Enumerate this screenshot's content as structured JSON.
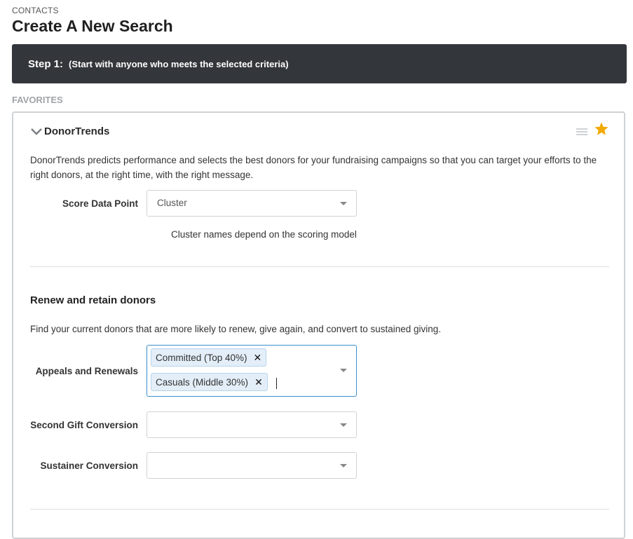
{
  "breadcrumb": "CONTACTS",
  "page_title": "Create A New Search",
  "step": {
    "label": "Step 1:",
    "description": "(Start with anyone who meets the selected criteria)"
  },
  "favorites_label": "FAVORITES",
  "panel": {
    "title": "DonorTrends",
    "description": "DonorTrends predicts performance and selects the best donors for your fundraising campaigns so that you can target your efforts to the right donors, at the right time, with the right message.",
    "score_data_point": {
      "label": "Score Data Point",
      "value": "Cluster",
      "hint": "Cluster names depend on the scoring model"
    },
    "section": {
      "title": "Renew and retain donors",
      "description": "Find your current donors that are more likely to renew, give again, and convert to sustained giving."
    },
    "appeals_renewals": {
      "label": "Appeals and Renewals",
      "tags": [
        "Committed (Top 40%)",
        "Casuals (Middle 30%)"
      ],
      "remove_glyph": "✕"
    },
    "second_gift": {
      "label": "Second Gift Conversion",
      "value": ""
    },
    "sustainer": {
      "label": "Sustainer Conversion",
      "value": ""
    }
  },
  "colors": {
    "step_bar": "#33363a",
    "star": "#f2a900",
    "focus_border": "#3a8fd0",
    "tag_bg": "#e3eef8"
  },
  "icons": {
    "collapse": "chevron-down-icon",
    "drag": "drag-handle-icon",
    "favorite": "star-icon"
  }
}
